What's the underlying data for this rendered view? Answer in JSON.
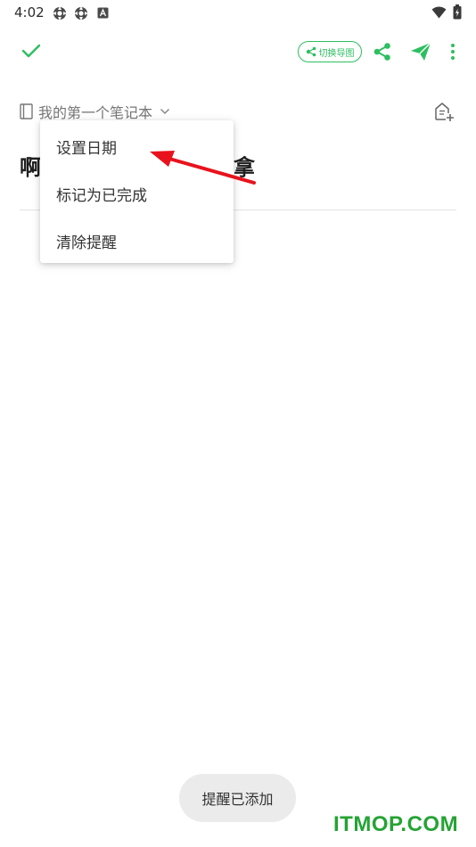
{
  "status_bar": {
    "time": "4:02",
    "icons": [
      "settings-gear-icon",
      "settings-gear-icon",
      "notification-a-icon",
      "wifi-icon",
      "battery-icon"
    ]
  },
  "toolbar": {
    "done_icon": "checkmark-icon",
    "mindmap_label": "切换导图",
    "share_icon": "share-icon",
    "send_icon": "paper-plane-icon",
    "more_icon": "more-vertical-icon"
  },
  "notebook": {
    "name": "我的第一个笔记本",
    "icon": "notebook-icon"
  },
  "note": {
    "title_start": "啊",
    "title_end": "拿"
  },
  "menu": {
    "items": [
      "设置日期",
      "标记为已完成",
      "清除提醒"
    ]
  },
  "toast": {
    "text": "提醒已添加"
  },
  "watermark": {
    "text": "ITMOP.COM"
  },
  "colors": {
    "accent": "#2dbe60",
    "annotation_arrow": "#e8121c",
    "watermark": "#25a335"
  }
}
